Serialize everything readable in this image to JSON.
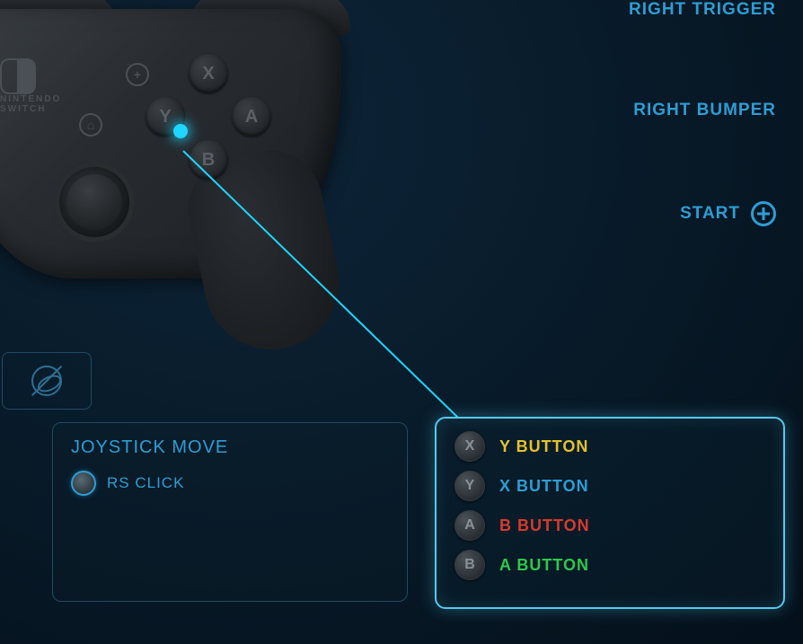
{
  "right_labels": {
    "trigger": "RIGHT TRIGGER",
    "bumper": "RIGHT BUMPER",
    "start": "START"
  },
  "joystick": {
    "title": "JOYSTICK MOVE",
    "rs_click": "RS CLICK"
  },
  "mappings": [
    {
      "badge": "X",
      "label": "Y BUTTON",
      "color": "c-yellow"
    },
    {
      "badge": "Y",
      "label": "X BUTTON",
      "color": "c-blue"
    },
    {
      "badge": "A",
      "label": "B BUTTON",
      "color": "c-red"
    },
    {
      "badge": "B",
      "label": "A BUTTON",
      "color": "c-green"
    }
  ],
  "controller": {
    "brand_top": "NINTENDO",
    "brand_bottom": "SWITCH",
    "face": {
      "x": "X",
      "y": "Y",
      "a": "A",
      "b": "B"
    }
  }
}
